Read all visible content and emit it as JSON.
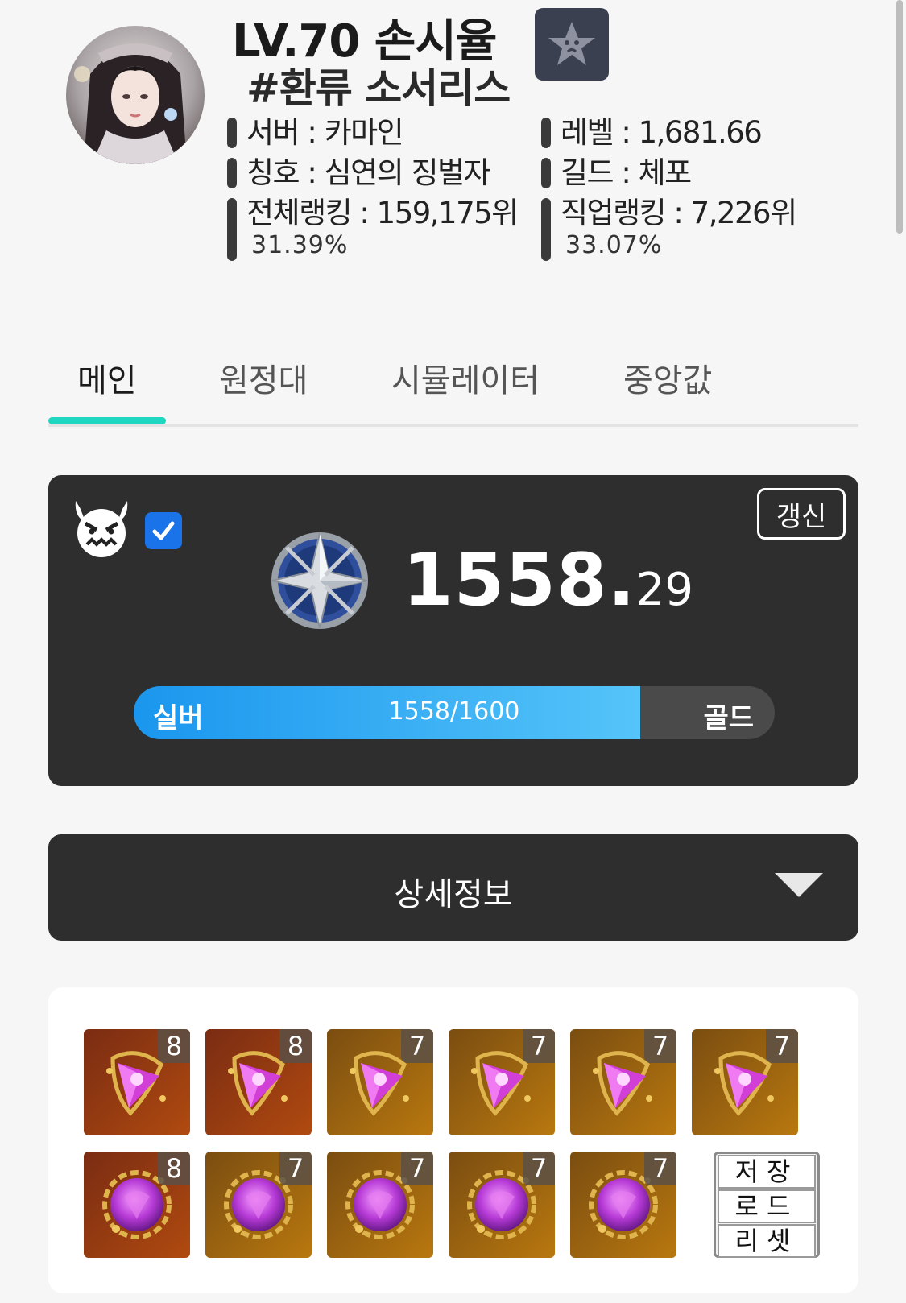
{
  "profile": {
    "title": "LV.70 손시율",
    "subtitle": "#환류 소서리스"
  },
  "info": {
    "server": "서버 : 카마인",
    "level": "레벨 : 1,681.66",
    "honor": "칭호 : 심연의 징벌자",
    "guild": "길드 : 체포",
    "total_rank": "전체랭킹 : 159,175위",
    "total_rank_pct": "31.39%",
    "class_rank": "직업랭킹 : 7,226위",
    "class_rank_pct": "33.07%"
  },
  "tabs": [
    "메인",
    "원정대",
    "시뮬레이터",
    "중앙값"
  ],
  "rating": {
    "refresh_label": "갱신",
    "score_int": "1558.",
    "score_dec": "29",
    "progress_fraction": 0.79,
    "tier_current": "실버",
    "tier_next": "골드",
    "progress_text": "1558/1600"
  },
  "details": {
    "label": "상세정보"
  },
  "gems": {
    "row1_levels": [
      "8",
      "8",
      "7",
      "7",
      "7",
      "7"
    ],
    "row2_levels": [
      "8",
      "7",
      "7",
      "7",
      "7"
    ],
    "preset": {
      "save": "저장",
      "load": "로드",
      "reset": "리셋"
    }
  },
  "colors": {
    "accent": "#1fd6c0",
    "card_bg": "#2e2e2e",
    "progress": "#1a96ee",
    "check": "#1a73e8"
  }
}
